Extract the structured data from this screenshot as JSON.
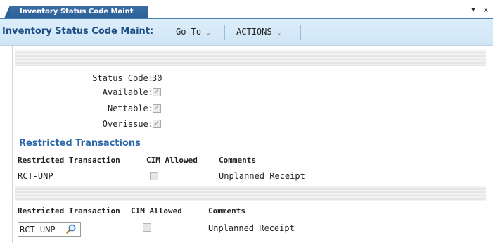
{
  "tab": {
    "label": "Inventory Status Code Maint",
    "controls": "▾ ×"
  },
  "header": {
    "title": "Inventory Status Code Maint:",
    "menus": [
      {
        "label": "Go To",
        "chevron": "⌄"
      },
      {
        "label": "ACTIONS",
        "chevron": "⌄"
      }
    ]
  },
  "fields": {
    "status_code": {
      "label": "Status Code:",
      "value": "30"
    },
    "available": {
      "label": "Available:",
      "checked": true
    },
    "nettable": {
      "label": "Nettable:",
      "checked": true
    },
    "overissue": {
      "label": "Overissue:",
      "checked": true
    }
  },
  "restricted": {
    "title": "Restricted Transactions",
    "columns": [
      "Restricted Transaction",
      "CIM Allowed",
      "Comments"
    ],
    "row": {
      "transaction": "RCT-UNP",
      "cim_allowed": false,
      "comments": "Unplanned Receipt"
    }
  },
  "editor": {
    "columns": [
      "Restricted Transaction",
      "CIM Allowed",
      "Comments"
    ],
    "transaction_value": "RCT-UNP",
    "cim_allowed": false,
    "comments": "Unplanned Receipt"
  },
  "colors": {
    "tab": "#2d5f97",
    "title": "#1f4e86",
    "section": "#2d68a8",
    "header_bg": "#d6eaf8"
  },
  "icons": {
    "lookup": "magnifier-icon",
    "checked": "check-icon"
  }
}
